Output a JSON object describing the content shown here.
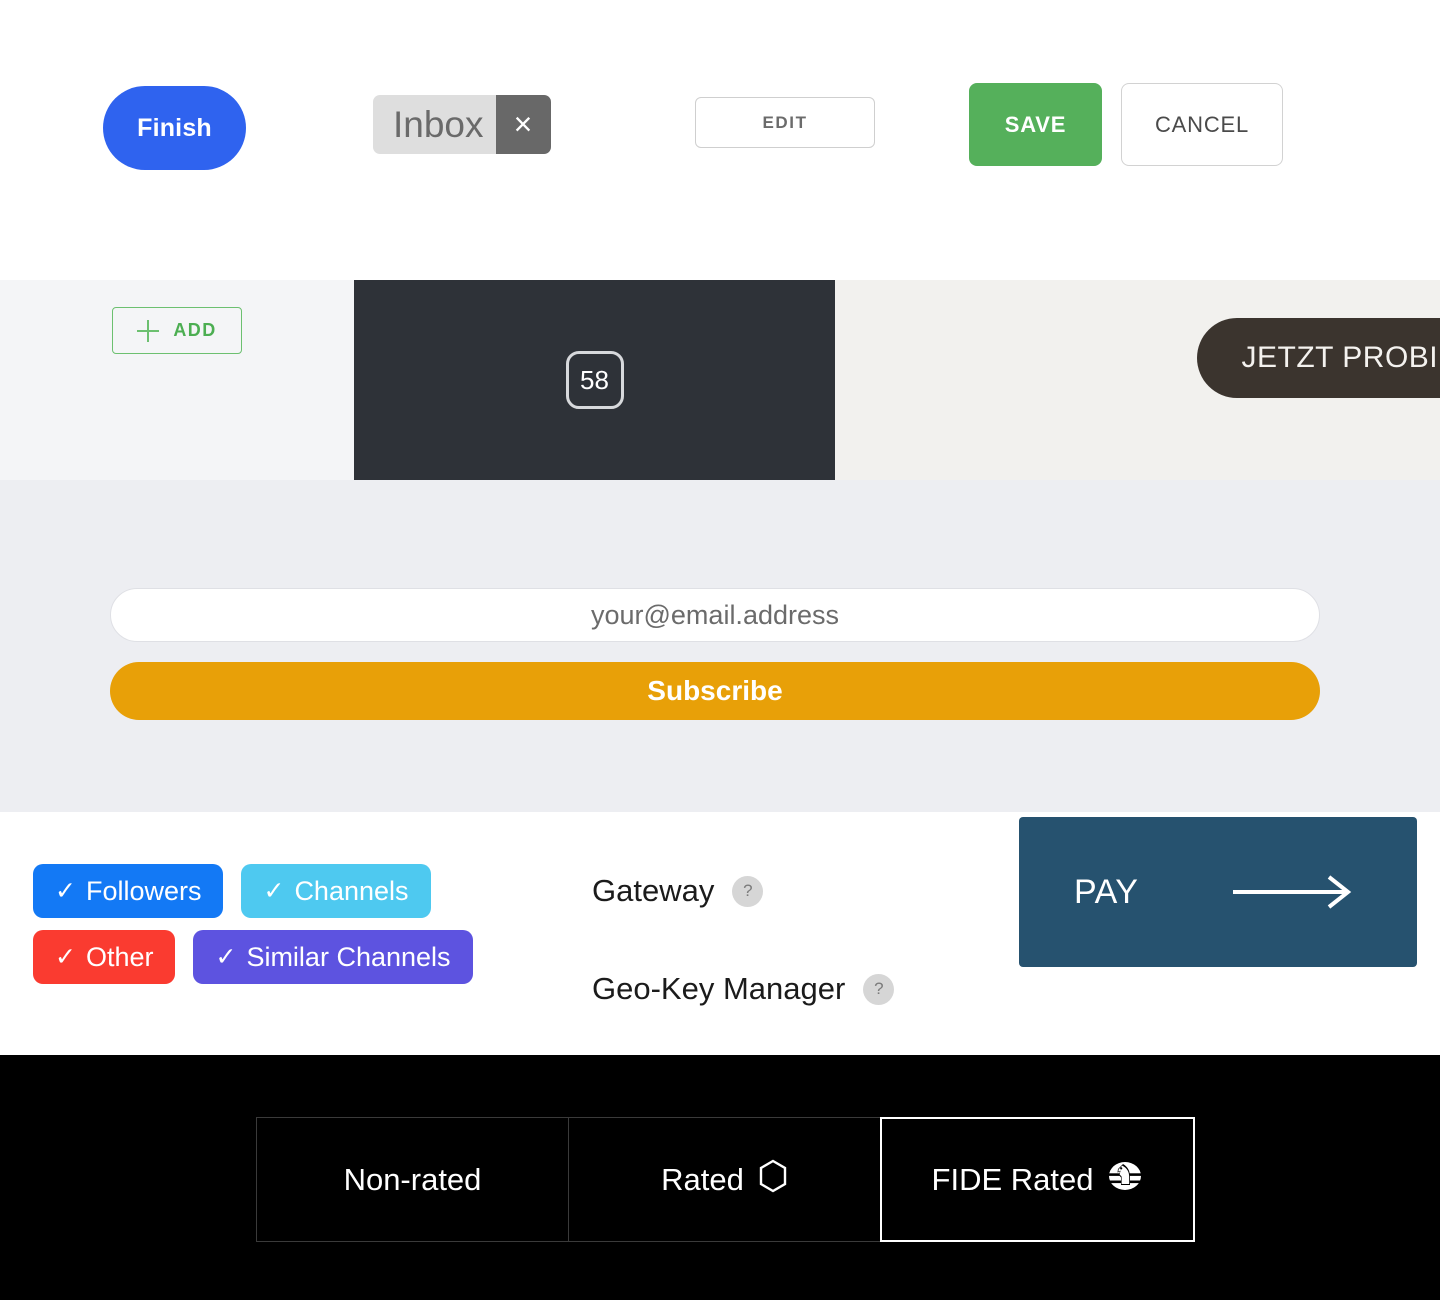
{
  "toolbar": {
    "finish_label": "Finish",
    "tag": {
      "label": "Inbox",
      "close_glyph": "×"
    },
    "edit_label": "EDIT",
    "save_label": "SAVE",
    "cancel_label": "CANCEL",
    "colors": {
      "finish_bg": "#2f63ef",
      "save_bg": "#55b05b",
      "tag_bg": "#dedede",
      "tag_close_bg": "#686868"
    }
  },
  "band": {
    "add_label": "ADD",
    "add_icon": "plus-icon",
    "badge_value": "58",
    "jetzt_label": "JETZT PROBIEREN",
    "colors": {
      "add_border": "#6cc070",
      "add_text": "#4cae52",
      "dark_panel_bg": "#2e3238",
      "jetzt_bg": "#3b342e"
    }
  },
  "subscribe": {
    "email_value": "",
    "email_placeholder": "your@email.address",
    "button_label": "Subscribe",
    "colors": {
      "section_bg": "#edeef2",
      "button_bg": "#e8a008"
    }
  },
  "filters": {
    "chips": [
      {
        "label": "Followers",
        "checked": true,
        "color": "#1379f5"
      },
      {
        "label": "Channels",
        "checked": true,
        "color": "#4ec9f0"
      },
      {
        "label": "Other",
        "checked": true,
        "color": "#fa3b30"
      },
      {
        "label": "Similar Channels",
        "checked": true,
        "color": "#5d53e0"
      }
    ],
    "check_glyph": "✓"
  },
  "settings": {
    "rows": [
      {
        "label": "Gateway",
        "help": "?"
      },
      {
        "label": "Geo-Key Manager",
        "help": "?"
      }
    ]
  },
  "pay": {
    "label": "PAY",
    "arrow_icon": "arrow-right-icon",
    "color": "#26526f"
  },
  "rating_segments": {
    "items": [
      {
        "label": "Non-rated",
        "icon": "none",
        "selected": false
      },
      {
        "label": "Rated",
        "icon": "hexagon-icon",
        "selected": false
      },
      {
        "label": "FIDE Rated",
        "icon": "fide-icon",
        "selected": true
      }
    ]
  }
}
